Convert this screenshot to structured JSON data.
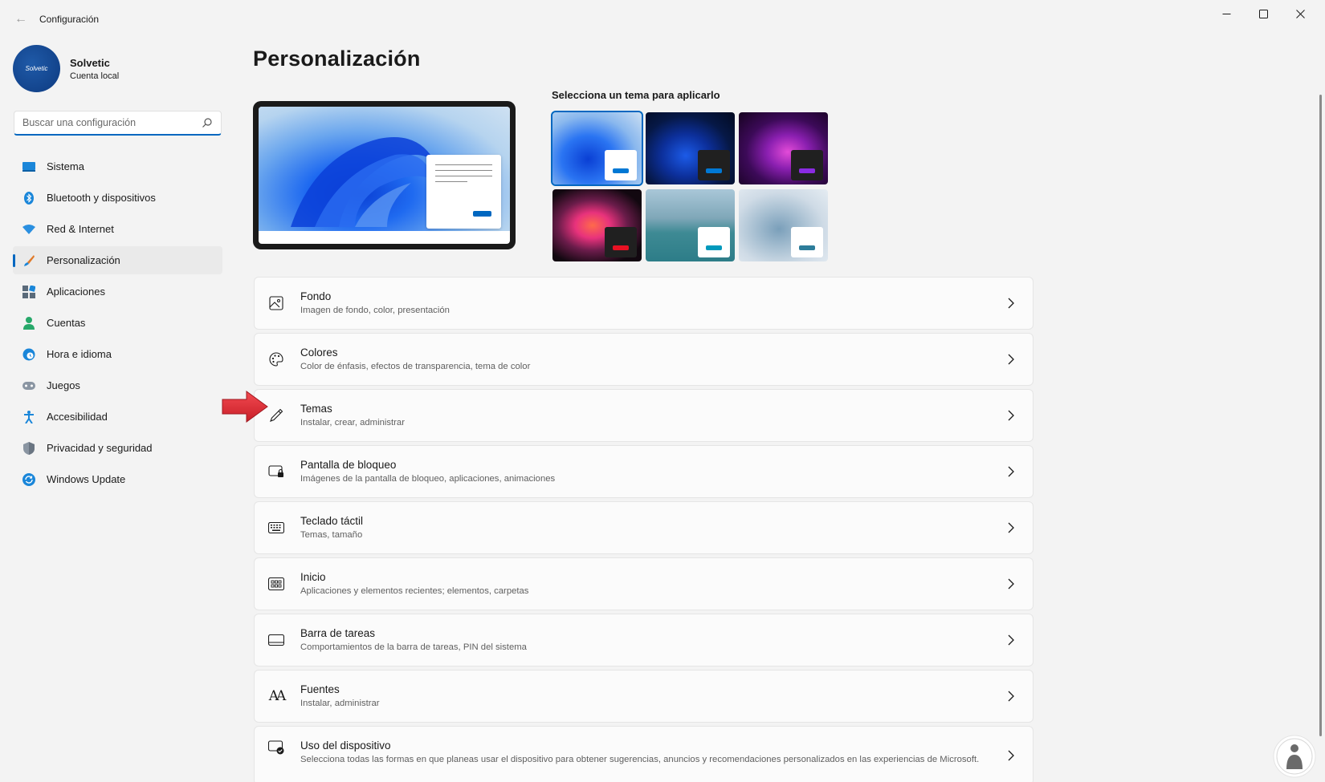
{
  "window": {
    "title": "Configuración",
    "back_glyph": "←",
    "controls": [
      "minimize-icon",
      "maximize-icon",
      "close-icon"
    ]
  },
  "profile": {
    "avatar_text": "Solvetic",
    "name": "Solvetic",
    "account_type": "Cuenta local"
  },
  "search": {
    "placeholder": "Buscar una configuración",
    "icon": "search-icon"
  },
  "sidebar": {
    "items": [
      {
        "label": "Sistema",
        "icon": "monitor-icon",
        "active": false
      },
      {
        "label": "Bluetooth y dispositivos",
        "icon": "bluetooth-icon",
        "active": false
      },
      {
        "label": "Red & Internet",
        "icon": "wifi-icon",
        "active": false
      },
      {
        "label": "Personalización",
        "icon": "brush-icon",
        "active": true
      },
      {
        "label": "Aplicaciones",
        "icon": "apps-icon",
        "active": false
      },
      {
        "label": "Cuentas",
        "icon": "person-icon",
        "active": false
      },
      {
        "label": "Hora e idioma",
        "icon": "clock-globe-icon",
        "active": false
      },
      {
        "label": "Juegos",
        "icon": "gamepad-icon",
        "active": false
      },
      {
        "label": "Accesibilidad",
        "icon": "accessibility-icon",
        "active": false
      },
      {
        "label": "Privacidad y seguridad",
        "icon": "shield-icon",
        "active": false
      },
      {
        "label": "Windows Update",
        "icon": "update-icon",
        "active": false
      }
    ]
  },
  "main": {
    "title": "Personalización",
    "themes_label": "Selecciona un tema para aplicarlo",
    "themes": [
      {
        "name": "windows-light",
        "chip_color": "#ffffff",
        "accent": "#0078d4",
        "selected": true
      },
      {
        "name": "windows-dark",
        "chip_color": "#202020",
        "accent": "#0078d4",
        "selected": false
      },
      {
        "name": "glow",
        "chip_color": "#202020",
        "accent": "#8a2be2",
        "selected": false
      },
      {
        "name": "captured-motion",
        "chip_color": "#202020",
        "accent": "#e81123",
        "selected": false
      },
      {
        "name": "sunrise",
        "chip_color": "#ffffff",
        "accent": "#0099bc",
        "selected": false
      },
      {
        "name": "flow",
        "chip_color": "#ffffff",
        "accent": "#2d7d9a",
        "selected": false
      }
    ],
    "settings": [
      {
        "title": "Fondo",
        "subtitle": "Imagen de fondo, color, presentación",
        "icon": "image-icon"
      },
      {
        "title": "Colores",
        "subtitle": "Color de énfasis, efectos de transparencia, tema de color",
        "icon": "palette-icon"
      },
      {
        "title": "Temas",
        "subtitle": "Instalar, crear, administrar",
        "icon": "pen-icon"
      },
      {
        "title": "Pantalla de bloqueo",
        "subtitle": "Imágenes de la pantalla de bloqueo, aplicaciones, animaciones",
        "icon": "lock-screen-icon"
      },
      {
        "title": "Teclado táctil",
        "subtitle": "Temas, tamaño",
        "icon": "keyboard-icon"
      },
      {
        "title": "Inicio",
        "subtitle": "Aplicaciones y elementos recientes; elementos, carpetas",
        "icon": "start-icon"
      },
      {
        "title": "Barra de tareas",
        "subtitle": "Comportamientos de la barra de tareas, PIN del sistema",
        "icon": "taskbar-icon"
      },
      {
        "title": "Fuentes",
        "subtitle": "Instalar, administrar",
        "icon": "fonts-icon",
        "icon_text": "AA"
      },
      {
        "title": "Uso del dispositivo",
        "subtitle": "Selecciona todas las formas en que planeas usar el dispositivo para obtener sugerencias, anuncios y recomendaciones personalizados en las experiencias de Microsoft.",
        "icon": "device-usage-icon"
      }
    ]
  },
  "colors": {
    "accent": "#0067c0",
    "background": "#f3f3f3",
    "card": "#fbfbfb",
    "annotation_arrow": "#e8323c"
  }
}
